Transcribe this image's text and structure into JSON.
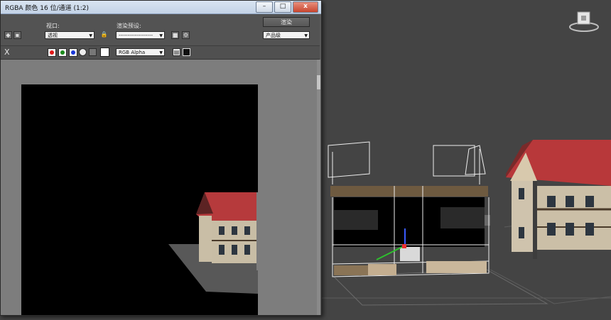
{
  "window": {
    "title": "RGBA 颜色 16 位/通道 (1:2)",
    "minimize_glyph": "–",
    "maximize_glyph": "□",
    "close_glyph": "x"
  },
  "toolbar": {
    "viewport_label": "视口:",
    "viewport_value": "透视",
    "preset_label": "渲染预设:",
    "preset_value": "-------------------",
    "render_label": "渲染",
    "render_mode_value": "产品级",
    "channel_value": "RGB Alpha",
    "clear_glyph": "X"
  },
  "channels": [
    {
      "name": "red",
      "color": "#e01818"
    },
    {
      "name": "green",
      "color": "#1a8a1a"
    },
    {
      "name": "blue",
      "color": "#1a38d8"
    }
  ],
  "colors": {
    "grid": "#5f5f5f",
    "roof": "#c8383b",
    "wire": "#ffffff"
  }
}
